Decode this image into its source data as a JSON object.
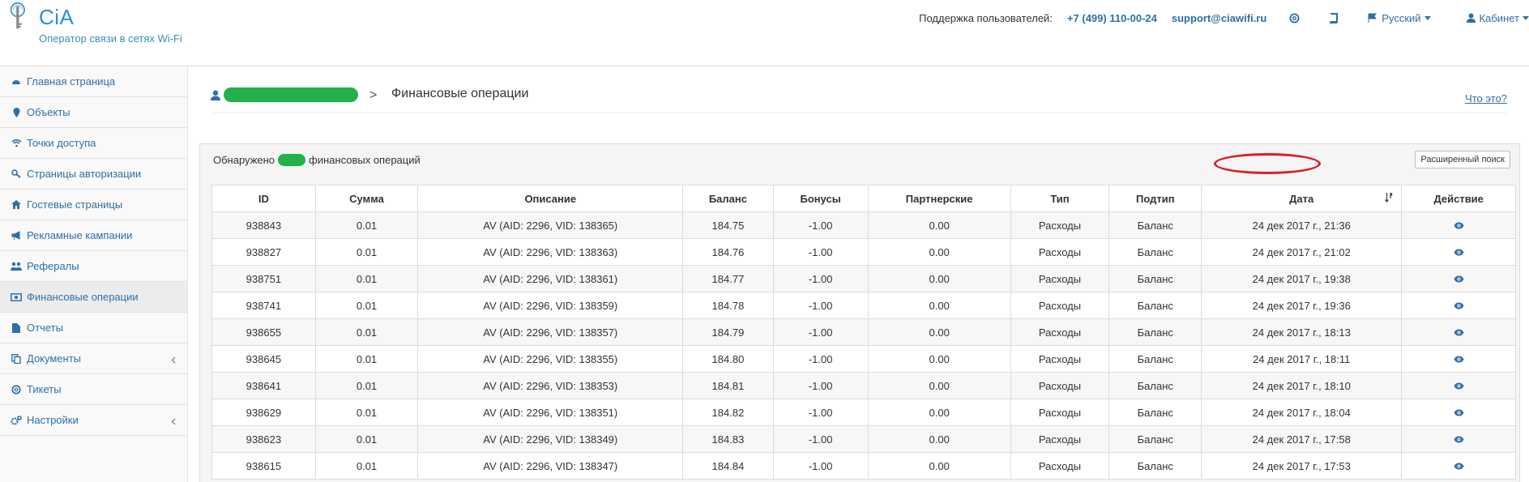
{
  "header": {
    "brand": "CiA",
    "tagline": "Оператор связи в сетях Wi-Fi",
    "support_label": "Поддержка пользователей:",
    "phone": "+7 (499) 110-00-24",
    "email": "support@ciawifi.ru",
    "language": "Русский",
    "cabinet": "Кабинет"
  },
  "sidebar": {
    "items": [
      {
        "label": "Главная страница",
        "icon": "dashboard-icon"
      },
      {
        "label": "Объекты",
        "icon": "map-marker-icon"
      },
      {
        "label": "Точки доступа",
        "icon": "wifi-icon"
      },
      {
        "label": "Страницы авторизации",
        "icon": "key-icon"
      },
      {
        "label": "Гостевые страницы",
        "icon": "home-icon"
      },
      {
        "label": "Рекламные кампании",
        "icon": "bullhorn-icon"
      },
      {
        "label": "Рефералы",
        "icon": "users-icon"
      },
      {
        "label": "Финансовые операции",
        "icon": "money-icon"
      },
      {
        "label": "Отчеты",
        "icon": "file-icon"
      },
      {
        "label": "Документы",
        "icon": "copy-icon"
      },
      {
        "label": "Тикеты",
        "icon": "lifebuoy-icon"
      },
      {
        "label": "Настройки",
        "icon": "cogs-icon"
      }
    ],
    "active_index": 7
  },
  "breadcrumb": {
    "separator": ">",
    "title": "Финансовые операции"
  },
  "help_link": "Что это?",
  "panel": {
    "found_prefix": "Обнаружено",
    "found_suffix": "финансовых операций",
    "advanced_search": "Расширенный поиск"
  },
  "table": {
    "columns": [
      "ID",
      "Сумма",
      "Описание",
      "Баланс",
      "Бонусы",
      "Партнерские",
      "Тип",
      "Подтип",
      "Дата",
      "Действие"
    ],
    "rows": [
      [
        "938843",
        "0.01",
        "AV (AID: 2296, VID: 138365)",
        "184.75",
        "-1.00",
        "0.00",
        "Расходы",
        "Баланс",
        "24 дек 2017 г., 21:36"
      ],
      [
        "938827",
        "0.01",
        "AV (AID: 2296, VID: 138363)",
        "184.76",
        "-1.00",
        "0.00",
        "Расходы",
        "Баланс",
        "24 дек 2017 г., 21:02"
      ],
      [
        "938751",
        "0.01",
        "AV (AID: 2296, VID: 138361)",
        "184.77",
        "-1.00",
        "0.00",
        "Расходы",
        "Баланс",
        "24 дек 2017 г., 19:38"
      ],
      [
        "938741",
        "0.01",
        "AV (AID: 2296, VID: 138359)",
        "184.78",
        "-1.00",
        "0.00",
        "Расходы",
        "Баланс",
        "24 дек 2017 г., 19:36"
      ],
      [
        "938655",
        "0.01",
        "AV (AID: 2296, VID: 138357)",
        "184.79",
        "-1.00",
        "0.00",
        "Расходы",
        "Баланс",
        "24 дек 2017 г., 18:13"
      ],
      [
        "938645",
        "0.01",
        "AV (AID: 2296, VID: 138355)",
        "184.80",
        "-1.00",
        "0.00",
        "Расходы",
        "Баланс",
        "24 дек 2017 г., 18:11"
      ],
      [
        "938641",
        "0.01",
        "AV (AID: 2296, VID: 138353)",
        "184.81",
        "-1.00",
        "0.00",
        "Расходы",
        "Баланс",
        "24 дек 2017 г., 18:10"
      ],
      [
        "938629",
        "0.01",
        "AV (AID: 2296, VID: 138351)",
        "184.82",
        "-1.00",
        "0.00",
        "Расходы",
        "Баланс",
        "24 дек 2017 г., 18:04"
      ],
      [
        "938623",
        "0.01",
        "AV (AID: 2296, VID: 138349)",
        "184.83",
        "-1.00",
        "0.00",
        "Расходы",
        "Баланс",
        "24 дек 2017 г., 17:58"
      ],
      [
        "938615",
        "0.01",
        "AV (AID: 2296, VID: 138347)",
        "184.84",
        "-1.00",
        "0.00",
        "Расходы",
        "Баланс",
        "24 дек 2017 г., 17:53"
      ]
    ]
  },
  "colors": {
    "link": "#2f6fa7",
    "brand": "#2a8fd3",
    "redaction": "#22b14c",
    "annotation": "#e01b24"
  }
}
